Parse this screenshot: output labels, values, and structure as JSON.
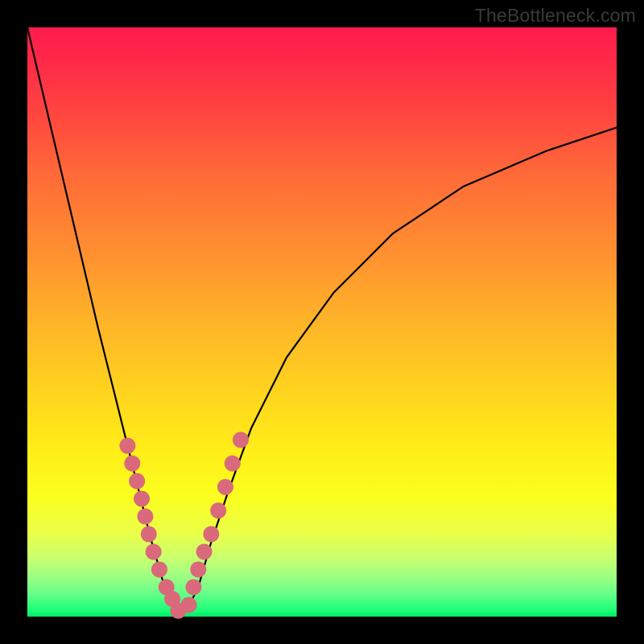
{
  "watermark": "TheBottleneck.com",
  "chart_data": {
    "type": "line",
    "title": "",
    "xlabel": "",
    "ylabel": "",
    "xlim": [
      0,
      100
    ],
    "ylim": [
      0,
      100
    ],
    "vertex_x": 26,
    "curve": {
      "x": [
        0,
        4,
        8,
        12,
        16,
        19,
        21,
        23,
        25,
        26,
        27,
        29,
        31,
        34,
        38,
        44,
        52,
        62,
        74,
        88,
        100
      ],
      "y": [
        100,
        83,
        66,
        49,
        33,
        21,
        13,
        6,
        1,
        0,
        1,
        5,
        12,
        21,
        32,
        44,
        55,
        65,
        73,
        79,
        83
      ]
    },
    "markers": {
      "left": {
        "x": [
          17.0,
          17.8,
          18.6,
          19.4,
          20.0,
          20.6,
          21.4,
          22.4,
          23.6,
          24.6,
          25.6
        ],
        "y": [
          29,
          26,
          23,
          20,
          17,
          14,
          11,
          8,
          5,
          3,
          1
        ]
      },
      "right": {
        "x": [
          27.4,
          28.2,
          29.0,
          30.0,
          31.2,
          32.4,
          33.6,
          34.8,
          36.2
        ],
        "y": [
          2,
          5,
          8,
          11,
          14,
          18,
          22,
          26,
          30
        ]
      }
    },
    "marker_radius_px": 10
  }
}
